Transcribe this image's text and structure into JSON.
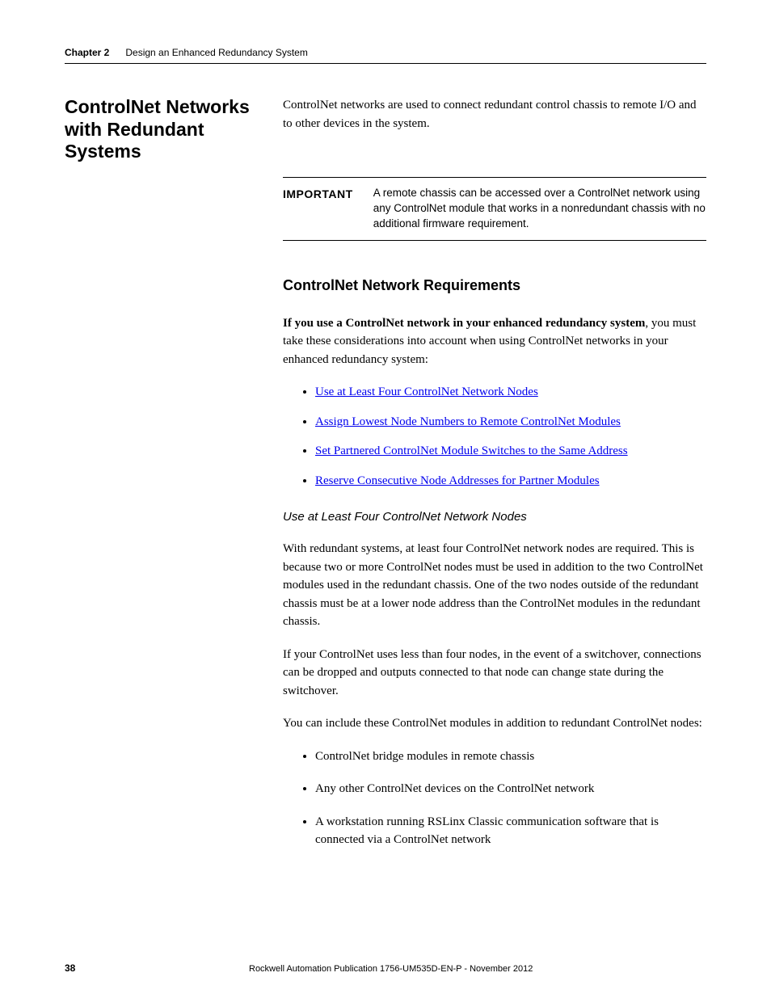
{
  "header": {
    "chapter_label": "Chapter 2",
    "chapter_title": "Design an Enhanced Redundancy System"
  },
  "section": {
    "heading": "ControlNet Networks with Redundant Systems",
    "intro": "ControlNet networks are used to connect redundant control chassis to remote I/O and to other devices in the system."
  },
  "important": {
    "label": "IMPORTANT",
    "text": "A remote chassis can be accessed over a ControlNet network using any ControlNet module that works in a nonredundant chassis with no additional firmware requirement."
  },
  "subsection": {
    "heading": "ControlNet Network Requirements",
    "lead_bold": "If you use a ControlNet network in your enhanced redundancy system",
    "lead_rest": ", you must take these considerations into account when using ControlNet networks in your enhanced redundancy system:",
    "links": [
      "Use at Least Four ControlNet Network Nodes",
      "Assign Lowest Node Numbers to Remote ControlNet Modules",
      "Set Partnered ControlNet Module Switches to the Same Address",
      "Reserve Consecutive Node Addresses for Partner Modules"
    ]
  },
  "sub3": {
    "heading": "Use at Least Four ControlNet Network Nodes",
    "p1": "With redundant systems, at least four ControlNet network nodes are required. This is because two or more ControlNet nodes must be used in addition to the two ControlNet modules used in the redundant chassis. One of the two nodes outside of the redundant chassis must be at a lower node address than the ControlNet modules in the redundant chassis.",
    "p2": "If your ControlNet uses less than four nodes, in the event of a switchover, connections can be dropped and outputs connected to that node can change state during the switchover.",
    "p3": "You can include these ControlNet modules in addition to redundant ControlNet nodes:",
    "items": [
      "ControlNet bridge modules in remote chassis",
      "Any other ControlNet devices on the ControlNet network",
      "A workstation running RSLinx Classic communication software that is connected via a ControlNet network"
    ]
  },
  "footer": {
    "page": "38",
    "pub": "Rockwell Automation Publication 1756-UM535D-EN-P - November 2012"
  }
}
